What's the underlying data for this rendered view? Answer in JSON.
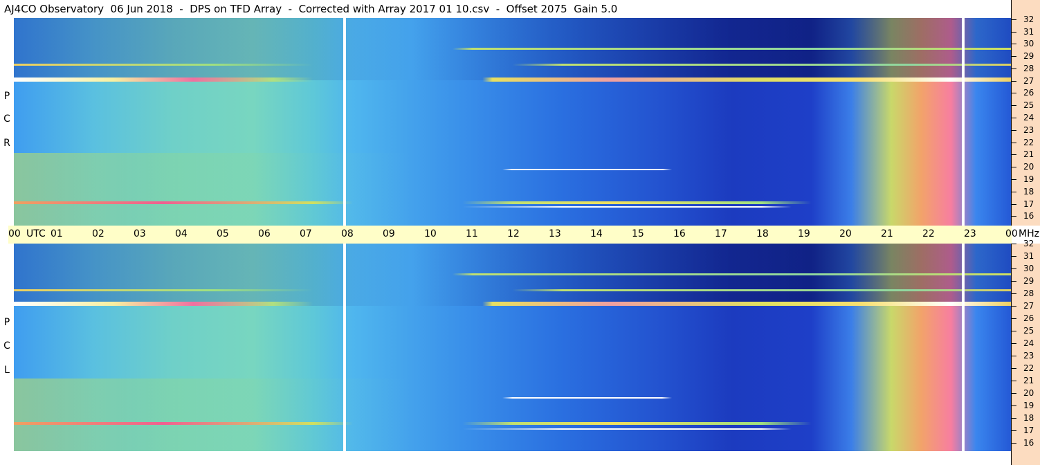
{
  "title": "AJ4CO Observatory  06 Jun 2018  -  DPS on TFD Array  -  Corrected with Array 2017 01 10.csv  -  Offset 2075  Gain 5.0",
  "panels": [
    {
      "name": "RCP",
      "letters": [
        "P",
        "C",
        "R"
      ]
    },
    {
      "name": "LCP",
      "letters": [
        "P",
        "C",
        "L"
      ]
    }
  ],
  "time_axis": {
    "start_label": "00",
    "utc_label": "UTC",
    "hours": [
      "01",
      "02",
      "03",
      "04",
      "05",
      "06",
      "07",
      "08",
      "09",
      "10",
      "11",
      "12",
      "13",
      "14",
      "15",
      "16",
      "17",
      "18",
      "19",
      "20",
      "21",
      "22",
      "23",
      "00"
    ],
    "unit_label": "MHz"
  },
  "frequency_scale": [
    "32",
    "31",
    "30",
    "29",
    "28",
    "27",
    "26",
    "25",
    "24",
    "23",
    "22",
    "21",
    "20",
    "19",
    "18",
    "17",
    "16"
  ],
  "colors": {
    "axis_bar": "#fffec8",
    "scale_bar": "#fcdcc0",
    "data_gap": "#ffffff"
  }
}
